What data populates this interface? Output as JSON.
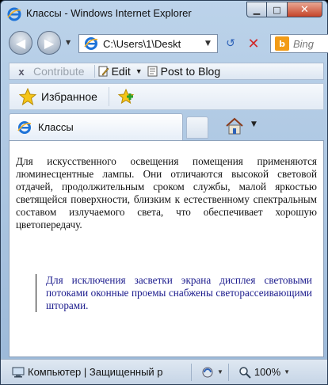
{
  "window": {
    "title": "Классы - Windows Internet Explorer",
    "minimize_glyph": "▁",
    "maximize_glyph": "□",
    "close_glyph": "✕"
  },
  "address_bar": {
    "url": "C:\\Users\\1\\Deskt",
    "dropdown_glyph": "▼",
    "back_glyph": "◀",
    "forward_glyph": "▶",
    "nav_dropdown_glyph": "▼",
    "refresh_glyph": "↺",
    "stop_glyph": "✕"
  },
  "search": {
    "placeholder": "Bing",
    "provider_icon_letter": "b"
  },
  "command_bar": {
    "close_glyph": "x",
    "contribute_label": "Contribute",
    "edit_label": "Edit",
    "dropdown_glyph": "▼",
    "blog_label": "Post to Blog"
  },
  "favorites_bar": {
    "favorites_label": "Избранное"
  },
  "tabs": [
    {
      "label": "Классы",
      "active": true
    }
  ],
  "home": {
    "dropdown_glyph": "▼"
  },
  "content": {
    "paragraph": "Для искусственного освещения помещения применяются люминесцентные лампы. Они отличаются высокой световой отдачей, продолжительным сроком службы, малой яркостью светящейся поверхности, близким к естественному спектральным составом излучаемого света, что обеспечивает хорошую цветопередачу.",
    "quote": "Для исключения засветки экрана дисплея световыми потоками оконные проемы снабжены светорассеивающими шторами."
  },
  "status_bar": {
    "zone_text": "Компьютер | Защищенный р",
    "zoom": "100%",
    "dropdown_glyph": "▼"
  },
  "colors": {
    "quote_text": "#1a1a8c",
    "close_button": "#c5442a",
    "frame": "#9bb8d8"
  },
  "icons": [
    "ie-icon",
    "back-arrow-icon",
    "forward-arrow-icon",
    "refresh-icon",
    "stop-icon",
    "bing-icon",
    "edit-icon",
    "blog-icon",
    "favorites-star-icon",
    "add-favorites-icon",
    "home-icon",
    "computer-icon",
    "protected-mode-icon",
    "zoom-icon"
  ]
}
